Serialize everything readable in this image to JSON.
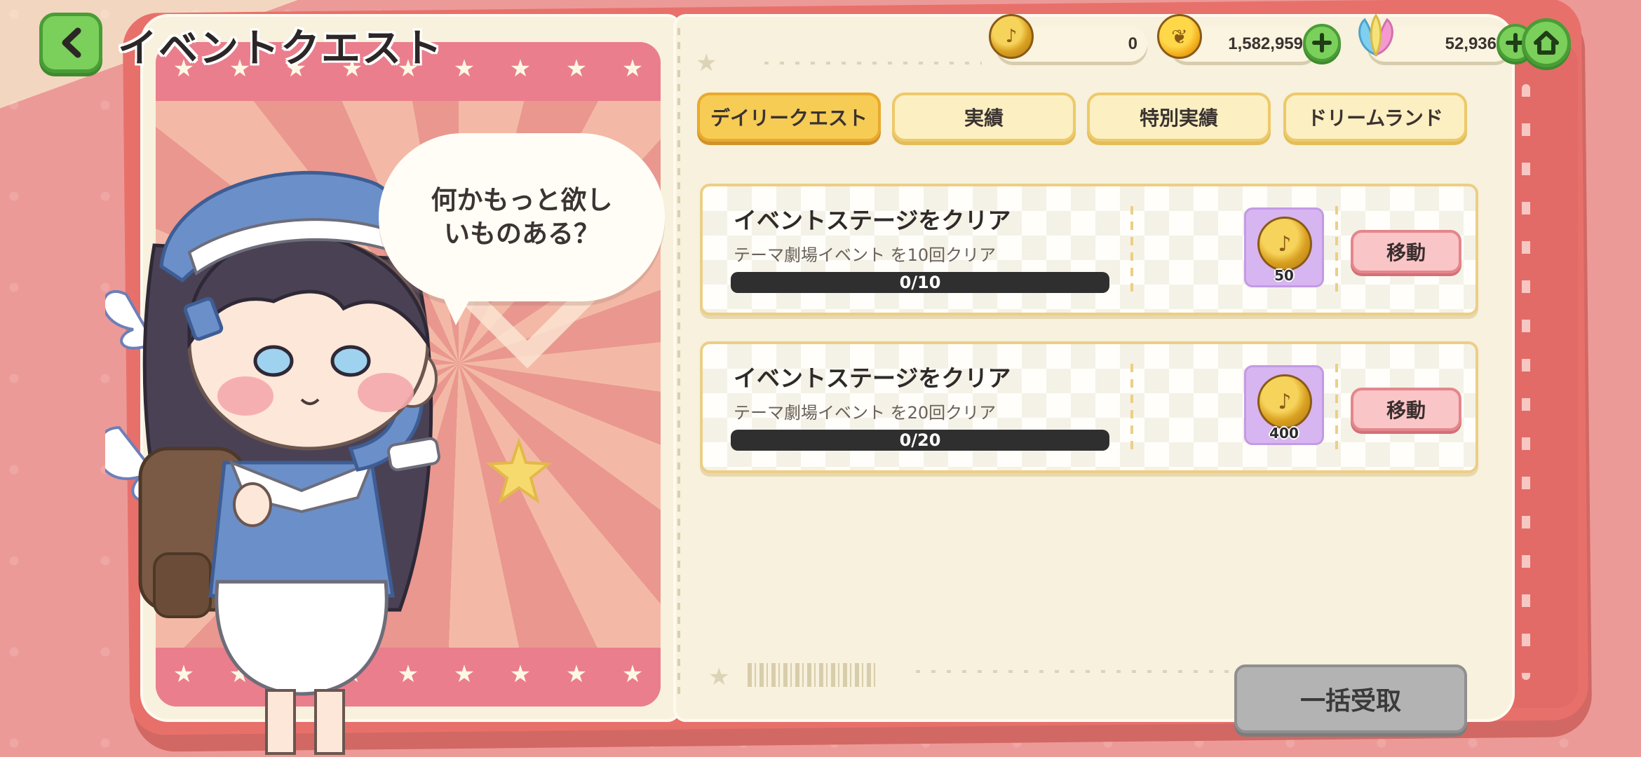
{
  "header": {
    "title": "イベントクエスト"
  },
  "currency": [
    {
      "name": "event-coin",
      "value": "0"
    },
    {
      "name": "leaf-coin",
      "value": "1,582,959"
    },
    {
      "name": "crystal",
      "value": "52,936"
    }
  ],
  "speech": {
    "text": "何かもっと欲し\nいものある？"
  },
  "tabs": [
    {
      "label": "デイリークエスト",
      "active": true
    },
    {
      "label": "実績",
      "active": false
    },
    {
      "label": "特別実績",
      "active": false
    },
    {
      "label": "ドリームランド",
      "active": false
    }
  ],
  "quests": [
    {
      "title": "イベントステージをクリア",
      "description": "テーマ劇場イベント を10回クリア",
      "progress_text": "0/10",
      "progress": 0,
      "reward_qty": "50",
      "button": "移動"
    },
    {
      "title": "イベントステージをクリア",
      "description": "テーマ劇場イベント を20回クリア",
      "progress_text": "0/20",
      "progress": 0,
      "reward_qty": "400",
      "button": "移動"
    }
  ],
  "footer": {
    "claim_all": "一括受取"
  },
  "colors": {
    "accent_green": "#7bcf5b",
    "tab_active": "#f6cc55",
    "move_button": "#f9c5c7",
    "claim_disabled": "#b3b3b3"
  }
}
